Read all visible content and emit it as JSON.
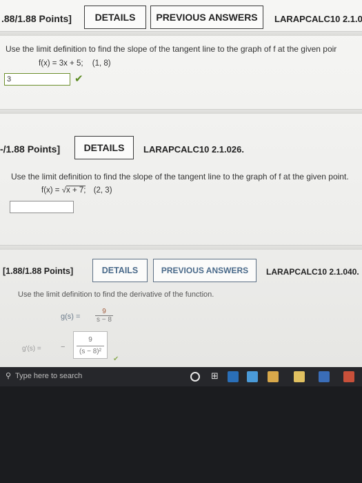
{
  "q1": {
    "points": ".88/1.88 Points]",
    "details_label": "DETAILS",
    "previous_label": "PREVIOUS ANSWERS",
    "code": "LARAPCALC10 2.1.0",
    "prompt": "Use the limit definition to find the slope of the tangent line to the graph of f at the given poir",
    "function": "f(x) = 3x + 5;",
    "point": "(1, 8)",
    "answer": "3"
  },
  "q2": {
    "points": "-/1.88 Points]",
    "details_label": "DETAILS",
    "code": "LARAPCALC10 2.1.026.",
    "prompt": "Use the limit definition to find the slope of the tangent line to the graph of f at the given point.",
    "function_prefix": "f(x) = ",
    "function_radicand": "x + 7;",
    "point": "(2, 3)",
    "answer": ""
  },
  "q3": {
    "points": "[1.88/1.88 Points]",
    "details_label": "DETAILS",
    "previous_label": "PREVIOUS ANSWERS",
    "code": "LARAPCALC10 2.1.040.",
    "prompt": "Use the limit definition to find the derivative of the function.",
    "function_lhs": "g(s) =",
    "function_num": "9",
    "function_den": "s − 8",
    "deriv_lhs": "g'(s) =",
    "deriv_sign": "−",
    "deriv_num": "9",
    "deriv_den": "(s − 8)²"
  },
  "taskbar": {
    "search_placeholder": "Type here to search"
  }
}
